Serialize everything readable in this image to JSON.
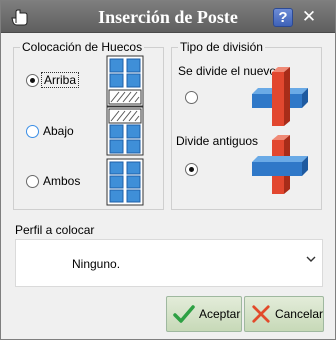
{
  "window": {
    "title": "Inserción de Poste",
    "icons": {
      "app": "hand-pointer-icon",
      "help": "help-icon",
      "close": "close-icon"
    },
    "help_label": "?",
    "close_label": "✕"
  },
  "colocacion": {
    "legend": "Colocación de Huecos",
    "options": [
      {
        "label": "Arriba",
        "selected": true,
        "icon": "window-top-hollow-icon"
      },
      {
        "label": "Abajo",
        "selected": false,
        "icon": "window-bottom-hollow-icon"
      },
      {
        "label": "Ambos",
        "selected": false,
        "icon": "window-both-hollow-icon"
      }
    ]
  },
  "tipo": {
    "legend": "Tipo de división",
    "options": [
      {
        "label": "Se divide el nuevo",
        "selected": false,
        "icon": "post-split-new-icon"
      },
      {
        "label": "Divide antiguos",
        "selected": true,
        "icon": "post-split-old-icon"
      }
    ]
  },
  "perfil": {
    "label": "Perfil a colocar",
    "value": "Ninguno.",
    "icon": "chevron-down-icon"
  },
  "buttons": {
    "accept": {
      "label": "Aceptar",
      "icon": "checkmark-icon"
    },
    "cancel": {
      "label": "Cancelar",
      "icon": "cross-icon"
    }
  },
  "colors": {
    "titlebar": "#6e6e6e",
    "glass": "#3f8fd8",
    "post_red": "#e2472f",
    "post_blue": "#2f78c8",
    "accept_check": "#2da043",
    "cancel_cross": "#e24a2a"
  }
}
